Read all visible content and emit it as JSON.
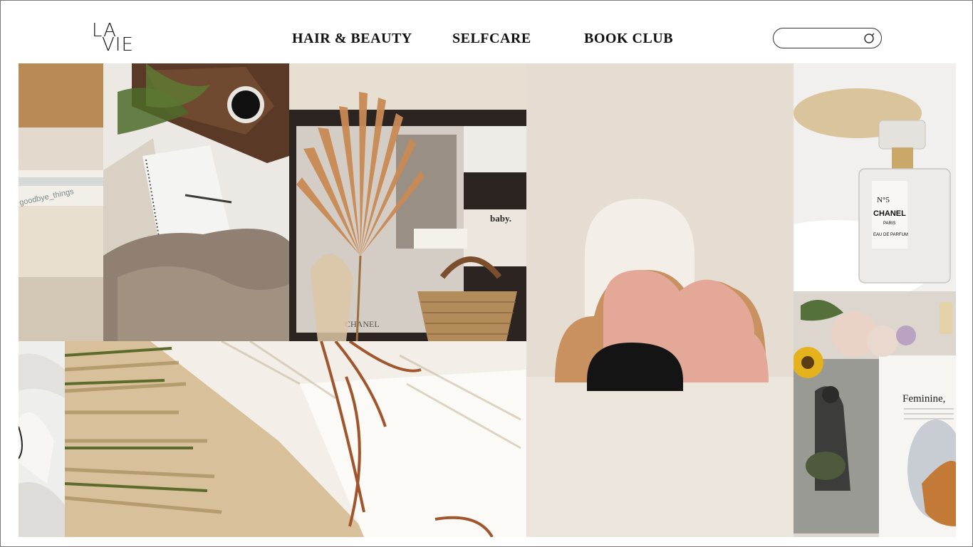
{
  "header": {
    "logo": {
      "line1": "LA",
      "line2": "VIE"
    },
    "nav": [
      {
        "label": "HAIR & BEAUTY"
      },
      {
        "label": "SELFCARE"
      },
      {
        "label": "BOOK CLUB"
      }
    ],
    "search": {
      "value": "",
      "placeholder": "",
      "icon": "search-icon"
    }
  },
  "gallery": {
    "tiles": [
      {
        "subject": "book-spine",
        "visible_text": "goodbye_things"
      },
      {
        "subject": "bed-coffee-notebook",
        "visible_text": ""
      },
      {
        "subject": "palm-basket-moodboard",
        "visible_text_1": "baby.",
        "visible_text_2": "CHANEL"
      },
      {
        "subject": "cloud-lamp",
        "visible_text": ""
      },
      {
        "subject": "perfume-bottle",
        "visible_text_1": "N°5",
        "visible_text_2": "CHANEL",
        "visible_text_3": "PARIS",
        "visible_text_4": "EAU DE PARFUM"
      },
      {
        "subject": "magazine-flowers",
        "visible_text": "Feminine,"
      },
      {
        "subject": "white-sheets",
        "visible_text": ""
      },
      {
        "subject": "palm-shadows",
        "visible_text": ""
      }
    ]
  },
  "colors": {
    "text": "#111111",
    "border": "#7a7a7a",
    "blush": "#e4a898",
    "tan": "#c9a27a",
    "cream": "#ede5da"
  }
}
